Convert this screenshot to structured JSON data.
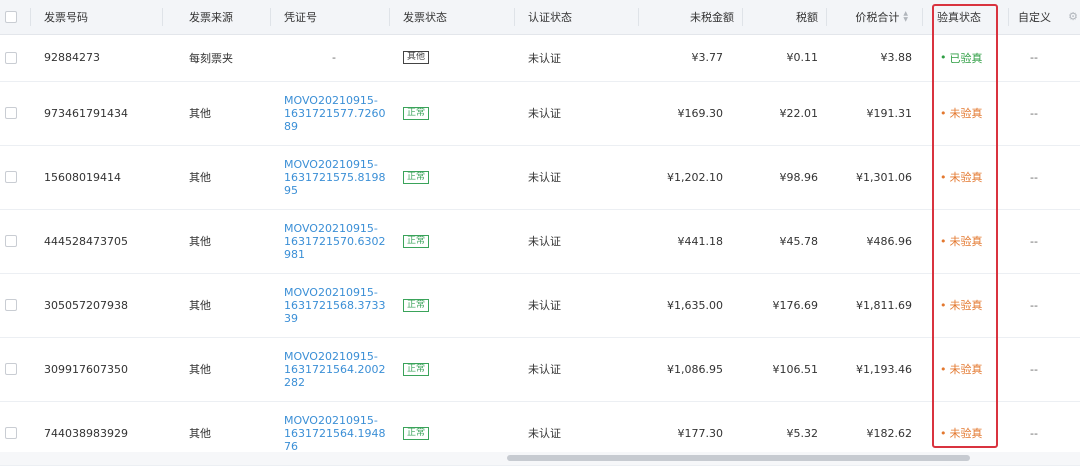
{
  "columns": {
    "invoice_no": "发票号码",
    "source": "发票来源",
    "voucher": "凭证号",
    "invoice_status": "发票状态",
    "auth_status": "认证状态",
    "amount": "未税金额",
    "tax": "税额",
    "total": "价税合计",
    "verify_status": "验真状态",
    "custom": "自定义"
  },
  "rows": [
    {
      "invoice_no": "92884273",
      "source": "每刻票夹",
      "voucher": [
        "-"
      ],
      "invoice_status": "其他",
      "auth_status": "未认证",
      "amount": "¥3.77",
      "tax": "¥0.11",
      "total": "¥3.88",
      "verify_status": "已验真",
      "verified": true,
      "custom": "--"
    },
    {
      "invoice_no": "973461791434",
      "source": "其他",
      "voucher": [
        "MOVO20210915-",
        "1631721577.7260",
        "89"
      ],
      "invoice_status": "正常",
      "auth_status": "未认证",
      "amount": "¥169.30",
      "tax": "¥22.01",
      "total": "¥191.31",
      "verify_status": "未验真",
      "verified": false,
      "custom": "--"
    },
    {
      "invoice_no": "15608019414",
      "source": "其他",
      "voucher": [
        "MOVO20210915-",
        "1631721575.8198",
        "95"
      ],
      "invoice_status": "正常",
      "auth_status": "未认证",
      "amount": "¥1,202.10",
      "tax": "¥98.96",
      "total": "¥1,301.06",
      "verify_status": "未验真",
      "verified": false,
      "custom": "--"
    },
    {
      "invoice_no": "444528473705",
      "source": "其他",
      "voucher": [
        "MOVO20210915-",
        "1631721570.6302",
        "981"
      ],
      "invoice_status": "正常",
      "auth_status": "未认证",
      "amount": "¥441.18",
      "tax": "¥45.78",
      "total": "¥486.96",
      "verify_status": "未验真",
      "verified": false,
      "custom": "--"
    },
    {
      "invoice_no": "305057207938",
      "source": "其他",
      "voucher": [
        "MOVO20210915-",
        "1631721568.3733",
        "39"
      ],
      "invoice_status": "正常",
      "auth_status": "未认证",
      "amount": "¥1,635.00",
      "tax": "¥176.69",
      "total": "¥1,811.69",
      "verify_status": "未验真",
      "verified": false,
      "custom": "--"
    },
    {
      "invoice_no": "309917607350",
      "source": "其他",
      "voucher": [
        "MOVO20210915-",
        "1631721564.2002",
        "282"
      ],
      "invoice_status": "正常",
      "auth_status": "未认证",
      "amount": "¥1,086.95",
      "tax": "¥106.51",
      "total": "¥1,193.46",
      "verify_status": "未验真",
      "verified": false,
      "custom": "--"
    },
    {
      "invoice_no": "744038983929",
      "source": "其他",
      "voucher": [
        "MOVO20210915-",
        "1631721564.1948",
        "76"
      ],
      "invoice_status": "正常",
      "auth_status": "未认证",
      "amount": "¥177.30",
      "tax": "¥5.32",
      "total": "¥182.62",
      "verify_status": "未验真",
      "verified": false,
      "custom": "--"
    }
  ],
  "colors": {
    "verified": "#2f9e44",
    "unverified": "#e3782f",
    "highlight": "#d9333f",
    "link": "#3b8fd6"
  }
}
